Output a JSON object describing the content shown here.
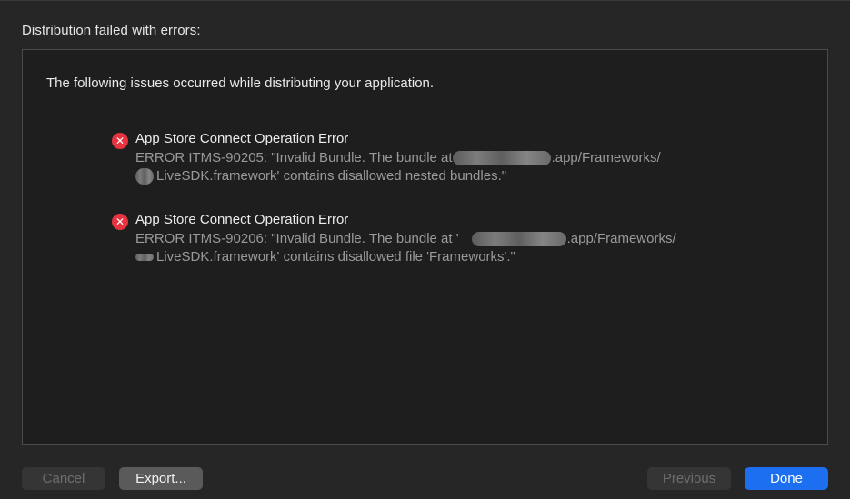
{
  "dialog": {
    "heading": "Distribution failed with errors:",
    "summary": "The following issues occurred while distributing your application."
  },
  "issues": [
    {
      "icon": "error-circle-icon",
      "title": "App Store Connect Operation Error",
      "line1_prefix": "ERROR ITMS-90205: \"Invalid Bundle. The bundle at",
      "line1_suffix": ".app/Frameworks/",
      "line2_suffix": "LiveSDK.framework' contains disallowed nested bundles.\""
    },
    {
      "icon": "error-circle-icon",
      "title": "App Store Connect Operation Error",
      "line1_prefix": "ERROR ITMS-90206: \"Invalid Bundle. The bundle at '",
      "line1_suffix": ".app/Frameworks/",
      "line2_suffix": "LiveSDK.framework' contains disallowed file 'Frameworks'.\""
    }
  ],
  "buttons": {
    "cancel": "Cancel",
    "export": "Export...",
    "previous": "Previous",
    "done": "Done"
  },
  "colors": {
    "error": "#e5343f",
    "primary": "#1b6ff0"
  }
}
